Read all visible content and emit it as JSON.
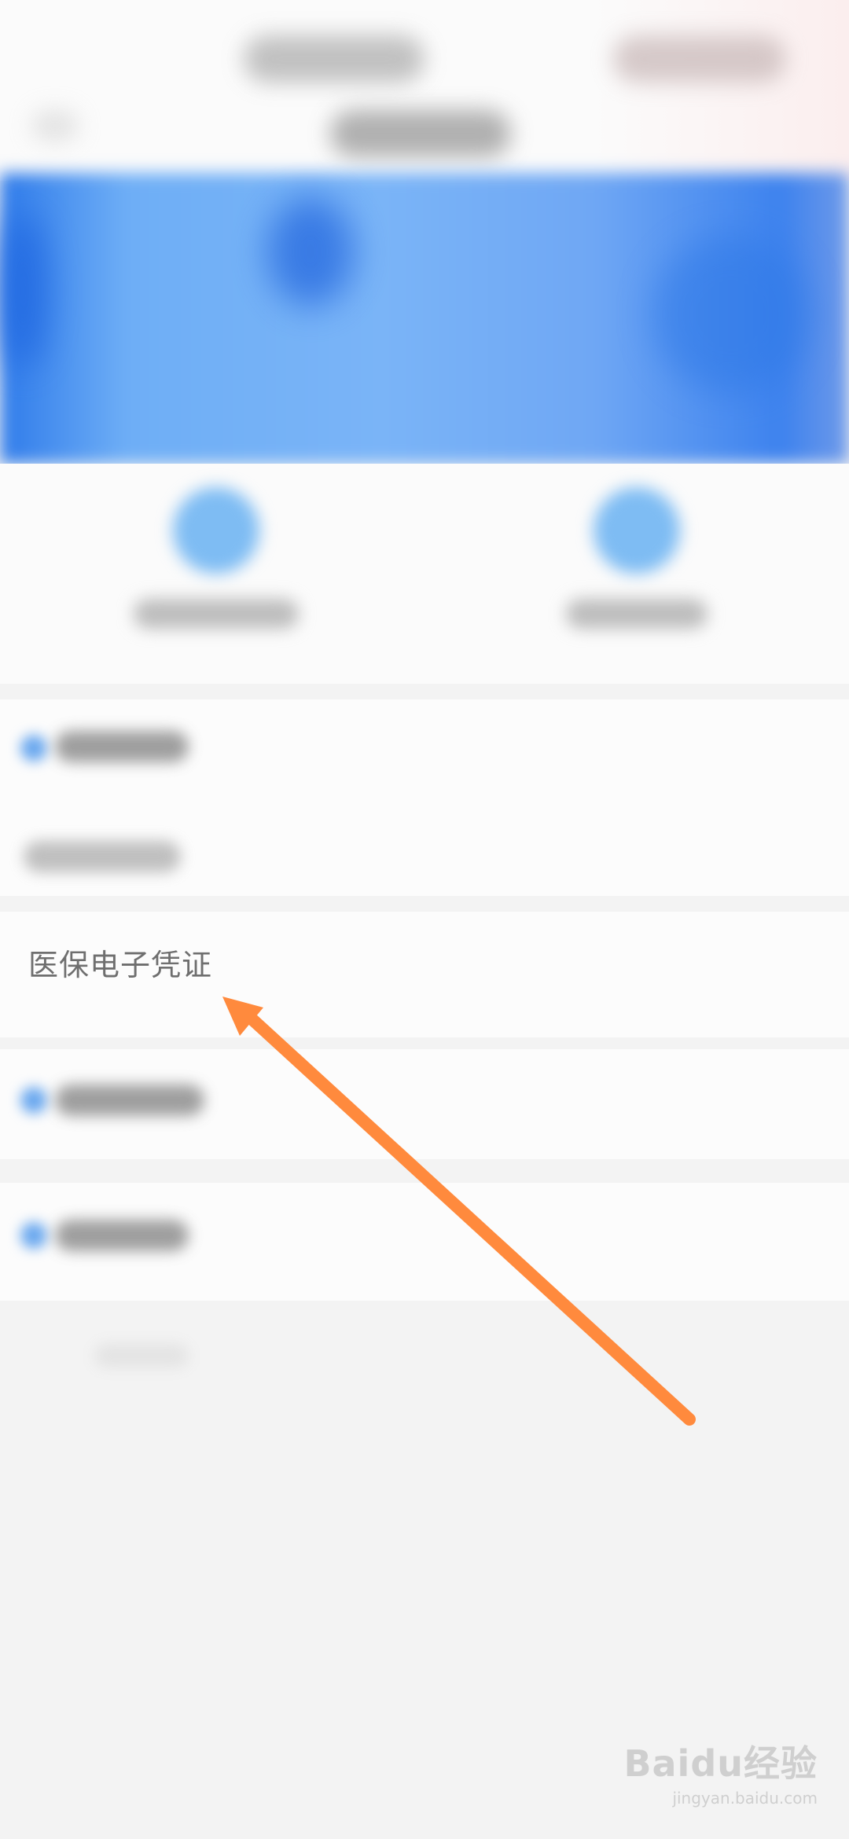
{
  "screen": {
    "highlighted_item_label": "医保电子凭证"
  },
  "annotation": {
    "arrow_color": "#ff8a3d"
  },
  "watermark": {
    "brand": "Baidu经验",
    "site": "jingyan.baidu.com"
  },
  "colors": {
    "banner_blue": "#6eaef6",
    "icon_blue": "#7ebcf3",
    "label_text": "#6f6f6f",
    "background": "#f3f3f3"
  }
}
